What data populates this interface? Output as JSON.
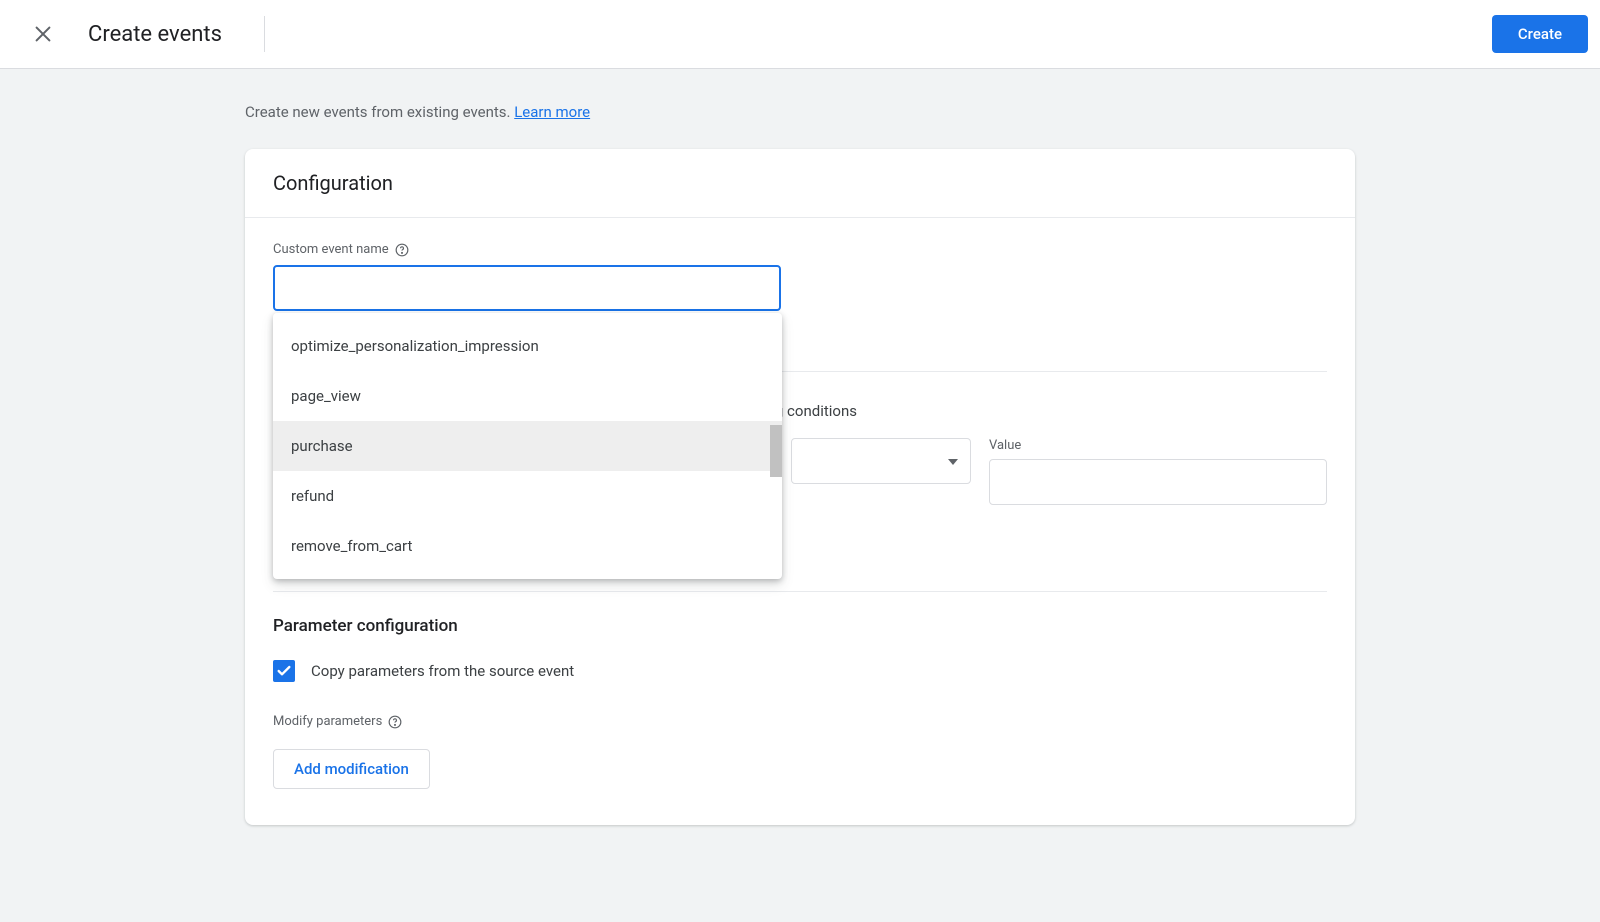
{
  "header": {
    "title": "Create events",
    "create_button": "Create"
  },
  "intro": {
    "text": "Create new events from existing events. ",
    "learn_more": "Learn more"
  },
  "configuration": {
    "title": "Configuration",
    "custom_event_label": "Custom event name",
    "custom_event_value": "",
    "dropdown_options": [
      {
        "label": "optimize_personalization_impression",
        "highlighted": false
      },
      {
        "label": "page_view",
        "highlighted": false
      },
      {
        "label": "purchase",
        "highlighted": true
      },
      {
        "label": "refund",
        "highlighted": false
      },
      {
        "label": "remove_from_cart",
        "highlighted": false
      }
    ],
    "conditions_text": "ving conditions",
    "value_label": "Value",
    "value_input": ""
  },
  "parameter_config": {
    "title": "Parameter configuration",
    "copy_params_checked": true,
    "copy_params_label": "Copy parameters from the source event",
    "modify_params_label": "Modify parameters",
    "add_modification_label": "Add modification"
  }
}
